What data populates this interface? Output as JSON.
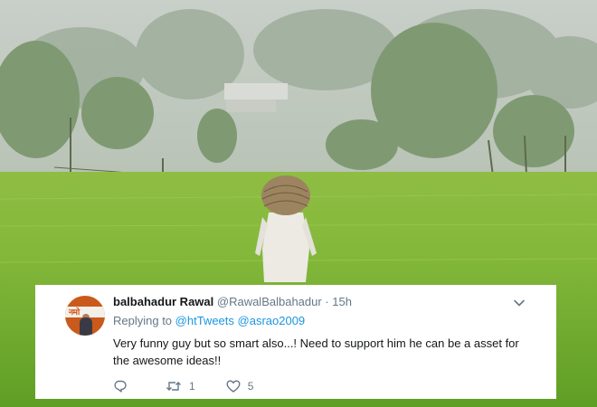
{
  "tweet": {
    "avatar_text": "नमो",
    "display_name": "balbahadur Rawal",
    "handle": "@RawalBalbahadur",
    "separator": "·",
    "time": "15h",
    "replying_to_label": "Replying to",
    "replying_to_1": "@htTweets",
    "replying_to_2": "@asrao2009",
    "text": "Very funny guy but so smart also...! Need to support him he can be a asset for the awesome ideas!!",
    "reply_icon": "reply-icon",
    "retweet_icon": "retweet-icon",
    "retweet_count": "1",
    "like_icon": "heart-icon",
    "like_count": "5",
    "accent_color": "#1b95e0"
  }
}
